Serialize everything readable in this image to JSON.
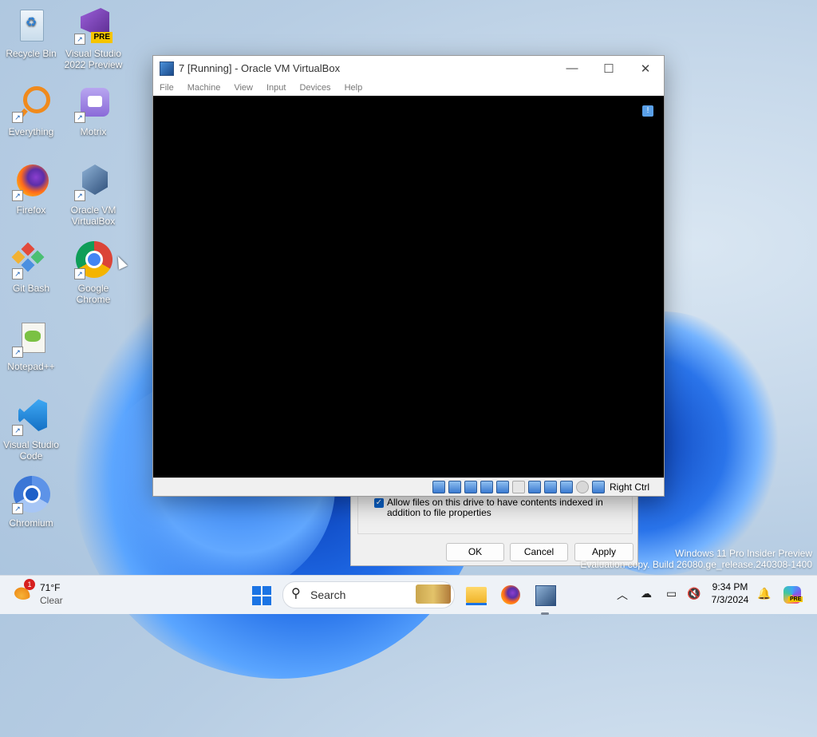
{
  "desktop": {
    "icons": [
      {
        "label": "Recycle Bin",
        "icon": "recycle-bin-icon"
      },
      {
        "label": "Visual Studio 2022 Preview",
        "icon": "visual-studio-icon",
        "badge": "PRE"
      },
      {
        "label": "Everything",
        "icon": "everything-search-icon"
      },
      {
        "label": "Motrix",
        "icon": "motrix-icon"
      },
      {
        "label": "Firefox",
        "icon": "firefox-icon"
      },
      {
        "label": "Oracle VM VirtualBox",
        "icon": "virtualbox-icon"
      },
      {
        "label": "Git Bash",
        "icon": "git-bash-icon"
      },
      {
        "label": "Google Chrome",
        "icon": "chrome-icon"
      },
      {
        "label": "Notepad++",
        "icon": "notepadpp-icon"
      },
      {
        "label": "Visual Studio Code",
        "icon": "vscode-icon"
      },
      {
        "label": "Chromium",
        "icon": "chromium-icon"
      }
    ],
    "watermark": {
      "line1": "Windows 11 Pro Insider Preview",
      "line2": "Evaluation copy. Build 26080.ge_release.240308-1400"
    }
  },
  "vbox": {
    "title": "7 [Running] - Oracle VM VirtualBox",
    "menu": [
      "File",
      "Machine",
      "View",
      "Input",
      "Devices",
      "Help"
    ],
    "host_key": "Right Ctrl",
    "status_icons": [
      "hard-disk-icon",
      "optical-drive-icon",
      "audio-icon",
      "network-icon",
      "usb-icon",
      "shared-folder-icon",
      "display-icon",
      "recording-icon",
      "cpu-icon",
      "mouse-integration-icon",
      "keyboard-icon"
    ]
  },
  "dialog": {
    "checkbox_label": "Allow files on this drive to have contents indexed in addition to file properties",
    "ok": "OK",
    "cancel": "Cancel",
    "apply": "Apply"
  },
  "taskbar": {
    "weather": {
      "temp": "71°F",
      "condition": "Clear",
      "badge": "1"
    },
    "search_placeholder": "Search",
    "time": "9:34 PM",
    "date": "7/3/2024",
    "colors": {
      "accent": "#1b74e4"
    }
  }
}
